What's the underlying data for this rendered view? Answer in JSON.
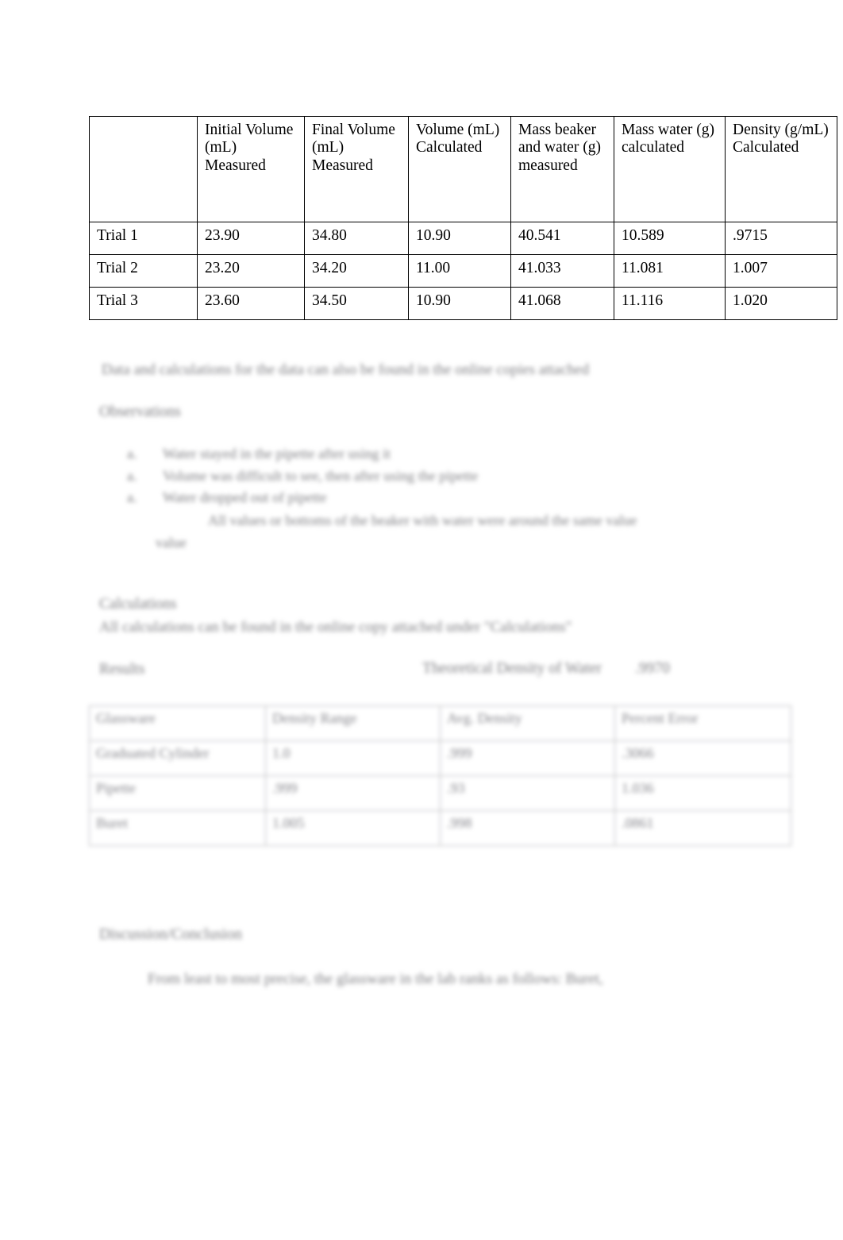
{
  "document": {
    "data_table": {
      "headers": [
        "",
        "Initial Volume (mL) Measured",
        "Final Volume (mL) Measured",
        "Volume (mL) Calculated",
        "Mass beaker and water (g) measured",
        "Mass water (g) calculated",
        "Density (g/mL) Calculated"
      ],
      "rows": [
        {
          "label": "Trial 1",
          "initial_volume": "23.90",
          "final_volume": "34.80",
          "volume_calculated": "10.90",
          "mass_beaker_water": "40.541",
          "mass_water": "10.589",
          "density": ".9715"
        },
        {
          "label": "Trial 2",
          "initial_volume": "23.20",
          "final_volume": "34.20",
          "volume_calculated": "11.00",
          "mass_beaker_water": "41.033",
          "mass_water": "11.081",
          "density": "1.007"
        },
        {
          "label": "Trial 3",
          "initial_volume": "23.60",
          "final_volume": "34.50",
          "volume_calculated": "10.90",
          "mass_beaker_water": "41.068",
          "mass_water": "11.116",
          "density": "1.020"
        }
      ]
    },
    "note": "Data and calculations for the data can also be found in the online copies attached",
    "observations_heading": "Observations",
    "observations": [
      {
        "bullet": "a.",
        "text": "Water stayed in the pipette after using it"
      },
      {
        "bullet": "a.",
        "text": "Volume was difficult to see, then after using the pipette"
      },
      {
        "bullet": "a.",
        "text": "Water dropped out of pipette"
      },
      {
        "bullet": "a.",
        "text": "All values or bottoms of the beaker with water were around the same value"
      },
      {
        "bullet": "",
        "text": ""
      }
    ],
    "calculations_heading": "Calculations",
    "calculations_text": "All calculations can be found in the online copy attached under \"Calculations\"",
    "results_heading": "Results",
    "theoretical_label": "Theoretical Density of Water",
    "theoretical_value": ".9970",
    "results_table": {
      "headers": [
        "Glassware",
        "Density Range",
        "Avg. Density",
        "Percent Error"
      ],
      "rows": [
        [
          "Graduated Cylinder",
          "1.0",
          ".999",
          ".3066"
        ],
        [
          "Pipette",
          ".999",
          ".93",
          "1.036"
        ],
        [
          "Buret",
          "1.005",
          ".998",
          ".0861"
        ]
      ]
    },
    "discussion_heading": "Discussion/Conclusion",
    "discussion_text": "From least to most precise, the glassware in the lab ranks as follows: Buret,"
  }
}
